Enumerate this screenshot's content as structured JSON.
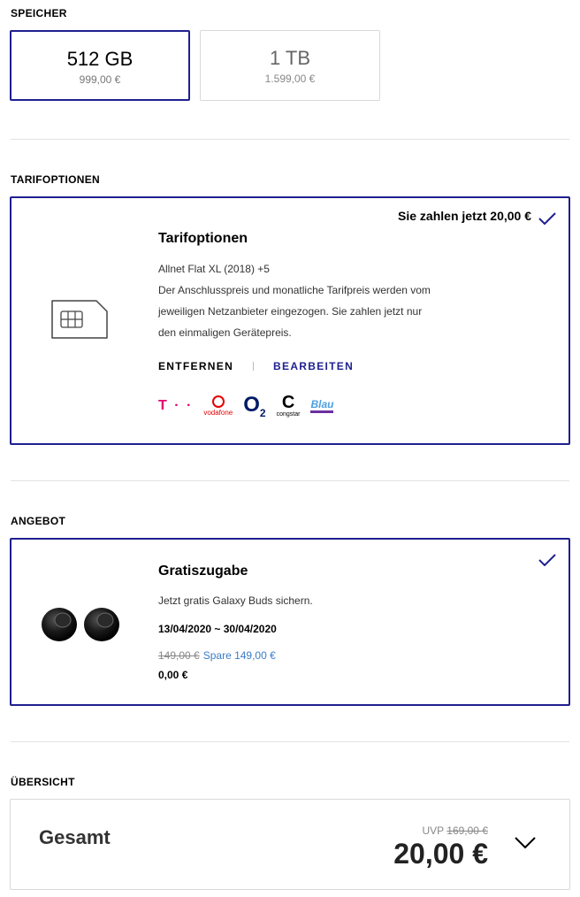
{
  "storage": {
    "title": "SPEICHER",
    "options": [
      {
        "capacity": "512 GB",
        "price": "999,00 €",
        "selected": true
      },
      {
        "capacity": "1 TB",
        "price": "1.599,00 €",
        "selected": false
      }
    ]
  },
  "tariff": {
    "section_title": "TARIFOPTIONEN",
    "pay_now": "Sie zahlen jetzt 20,00 €",
    "title": "Tarifoptionen",
    "plan": "Allnet Flat XL (2018) +5",
    "description_lines": [
      "Der Anschlusspreis und monatliche Tarifpreis werden vom",
      "jeweiligen Netzanbieter eingezogen. Sie zahlen jetzt nur",
      "den einmaligen Gerätepreis."
    ],
    "remove_label": "ENTFERNEN",
    "edit_label": "BEARBEITEN",
    "providers": {
      "telekom": "T · ·",
      "vodafone": "vodafone",
      "o2": "O",
      "o2_sub": "2",
      "congstar_mark": "C",
      "congstar": "congstar",
      "blau": "Blau"
    }
  },
  "offer": {
    "section_title": "ANGEBOT",
    "title": "Gratiszugabe",
    "subtitle": "Jetzt gratis Galaxy Buds sichern.",
    "date_range": "13/04/2020 ~ 30/04/2020",
    "old_price": "149,00 €",
    "save_text": "Spare 149,00 €",
    "price": "0,00 €"
  },
  "summary": {
    "section_title": "ÜBERSICHT",
    "label": "Gesamt",
    "uvp_label": "UVP",
    "uvp_price": "169,00 €",
    "total": "20,00 €"
  },
  "colors": {
    "accent": "#1f1f8f",
    "link_blue": "#3a7cc7",
    "telekom": "#e20074",
    "vodafone": "#e60000"
  }
}
